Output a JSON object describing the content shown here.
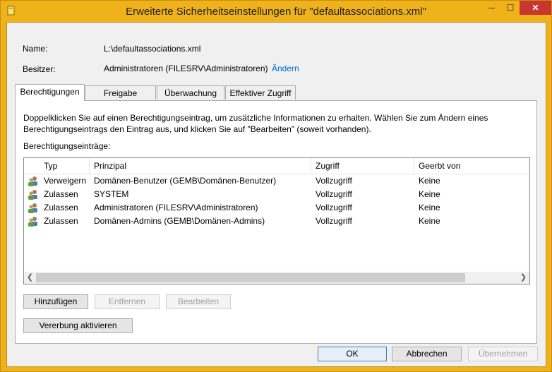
{
  "window": {
    "title": "Erweiterte Sicherheitseinstellungen für \"defaultassociations.xml\"",
    "minimize": "─",
    "maximize": "☐",
    "close": "✕"
  },
  "info": {
    "name_label": "Name:",
    "name_value": "L:\\defaultassociations.xml",
    "owner_label": "Besitzer:",
    "owner_value": "Administratoren (FILESRV\\Administratoren)",
    "change_link": "Ändern"
  },
  "tabs": [
    {
      "label": "Berechtigungen"
    },
    {
      "label": "Freigabe"
    },
    {
      "label": "Überwachung"
    },
    {
      "label": "Effektiver Zugriff"
    }
  ],
  "panel": {
    "description": "Doppelklicken Sie auf einen Berechtigungseintrag, um zusätzliche Informationen zu erhalten. Wählen Sie zum Ändern eines Berechtigungseintrags den Eintrag aus, und klicken Sie auf \"Bearbeiten\" (soweit vorhanden).",
    "entries_label": "Berechtigungseinträge:"
  },
  "list": {
    "columns": [
      "Typ",
      "Prinzipal",
      "Zugriff",
      "Geerbt von"
    ],
    "rows": [
      {
        "type": "Verweigern",
        "principal": "Domänen-Benutzer (GEMB\\Domänen-Benutzer)",
        "access": "Vollzugriff",
        "inherited": "Keine"
      },
      {
        "type": "Zulassen",
        "principal": "SYSTEM",
        "access": "Vollzugriff",
        "inherited": "Keine"
      },
      {
        "type": "Zulassen",
        "principal": "Administratoren (FILESRV\\Administratoren)",
        "access": "Vollzugriff",
        "inherited": "Keine"
      },
      {
        "type": "Zulassen",
        "principal": "Domänen-Admins (GEMB\\Domänen-Admins)",
        "access": "Vollzugriff",
        "inherited": "Keine"
      }
    ]
  },
  "buttons": {
    "add": "Hinzufügen",
    "remove": "Entfernen",
    "edit": "Bearbeiten",
    "inheritance": "Vererbung aktivieren",
    "ok": "OK",
    "cancel": "Abbrechen",
    "apply": "Übernehmen"
  }
}
